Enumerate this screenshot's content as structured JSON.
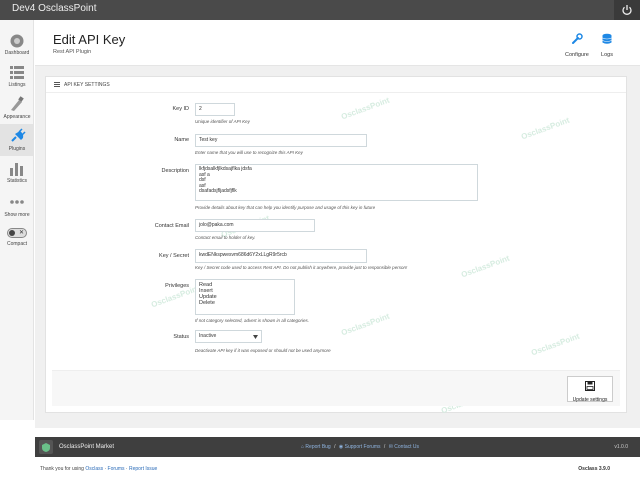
{
  "topbar": {
    "title": "Dev4 OsclassPoint"
  },
  "sidebar": {
    "items": [
      {
        "label": "Dashboard"
      },
      {
        "label": "Listings"
      },
      {
        "label": "Appearance"
      },
      {
        "label": "Plugins"
      },
      {
        "label": "Statistics"
      },
      {
        "label": "Show more"
      }
    ],
    "compact_label": "Compact"
  },
  "header": {
    "title": "Edit API Key",
    "subtitle": "Rest API Plugin",
    "configure_label": "Configure",
    "logs_label": "Logs"
  },
  "panel": {
    "title": "API KEY SETTINGS",
    "key_id": {
      "label": "Key ID",
      "value": "2",
      "hint": "Unique identifier of API Key"
    },
    "name": {
      "label": "Name",
      "value": "Test key",
      "hint": "Enter name that you will use to recognize this API Key"
    },
    "description": {
      "label": "Description",
      "lines": [
        "lkfjdsalkfjlkdsajflka jdsfa",
        "asf a",
        "dsf",
        "asf",
        "dsafadsjfljadsfjflk"
      ],
      "hint": "Provide details about key that can help you identify purpose and usage of this key in future"
    },
    "contact_email": {
      "label": "Contact Email",
      "value": "jolo@paka.com",
      "hint": "Contact email to holder of key."
    },
    "key_secret": {
      "label": "Key / Secret",
      "value": "kwdENkspwesvm686d6Y2xLLgR9r5rcb",
      "hint": "Key / Secret code used to access Rest API. Do not publish it anywhere, provide just to responsible person!"
    },
    "privileges": {
      "label": "Privileges",
      "options": [
        "Read",
        "Insert",
        "Update",
        "Delete"
      ],
      "hint": "If not category selected, advert is shown in all categories."
    },
    "status": {
      "label": "Status",
      "value": "Inactive",
      "hint": "Deactivate API key if it was exposed or should not be used anymore"
    },
    "update_label": "Update settings"
  },
  "watermark": "OsclassPoint",
  "bottombar": {
    "brand": "OsclassPoint Market",
    "report_bug": "Report Bug",
    "support_forums": "Support Forums",
    "contact_us": "Contact Us",
    "version": "v1.0.0"
  },
  "page_footer": {
    "prefix": "Thank you for using",
    "osclass": "Osclass",
    "forums": "Forums",
    "report_issue": "Report Issue",
    "version": "Osclass 3.9.0"
  },
  "colors": {
    "accent": "#1e88e5",
    "topbar": "#4a4a4a",
    "bottombar": "#3f3f3f"
  }
}
